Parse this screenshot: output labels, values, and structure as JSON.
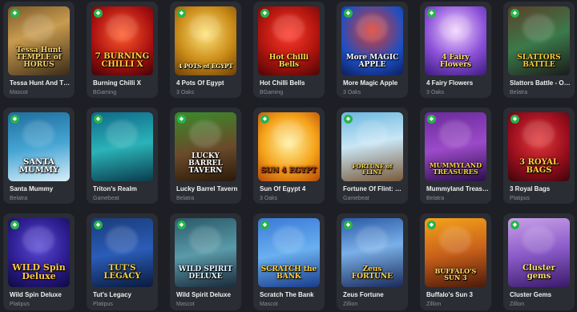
{
  "badge_icon": "diamond-icon",
  "colors": {
    "page_bg": "#1d1f24",
    "card_bg": "#2a2d33",
    "badge": "#27b44b"
  },
  "games": [
    {
      "title": "Tessa Hunt And The...",
      "provider": "Mascot",
      "logo": "Tessa Hunt TEMPLE of HORUS",
      "bg": "linear-gradient(160deg,#7a5a2a,#c89b4e 40%,#3a2a18)",
      "logo_color": "#f5d36b"
    },
    {
      "title": "Burning Chilli X",
      "provider": "BGaming",
      "logo": "7 BURNING CHILLI X",
      "bg": "radial-gradient(circle at 50% 40%,#ff5a2a,#a80f10 60%,#3b0508)",
      "logo_color": "#ffd23a"
    },
    {
      "title": "4 Pots Of Egypt",
      "provider": "3 Oaks",
      "logo": "4 POTS of EGYPT",
      "bg": "radial-gradient(circle at 50% 40%,#ffe37a,#c98a17 55%,#6b3e08)",
      "logo_color": "#fff3b0"
    },
    {
      "title": "Hot Chilli Bells",
      "provider": "BGaming",
      "logo": "Hot Chilli Bells",
      "bg": "radial-gradient(circle at 50% 40%,#ff3a2a,#b1150e 55%,#4a0506)",
      "logo_color": "#ffe14a"
    },
    {
      "title": "More Magic Apple",
      "provider": "3 Oaks",
      "logo": "More MAGIC APPLE",
      "bg": "radial-gradient(circle at 50% 35%,#e23a2a,#1d4fc4 60%,#0b1e5c)",
      "logo_color": "#ffffff"
    },
    {
      "title": "4 Fairy Flowers",
      "provider": "3 Oaks",
      "logo": "4 Fairy Flowers",
      "bg": "radial-gradient(circle at 50% 35%,#f5d6ff,#8a4fd8 55%,#3b1a7a)",
      "logo_color": "#ffe16b"
    },
    {
      "title": "Slattors Battle - Orc...",
      "provider": "Belatra",
      "logo": "SLATTORS BATTLE",
      "bg": "linear-gradient(160deg,#5b3f2a,#3b7a4a 50%,#1a1a1a)",
      "logo_color": "#ffc93a"
    },
    {
      "title": "Santa Mummy",
      "provider": "Belatra",
      "logo": "SANTA MUMMY",
      "bg": "linear-gradient(170deg,#1d6e9c,#46a5d4 50%,#d9eef8)",
      "logo_color": "#ffffff"
    },
    {
      "title": "Triton's Realm",
      "provider": "Gamebeat",
      "logo": "",
      "bg": "linear-gradient(170deg,#0e6a8a,#2bb3b8 50%,#0a3c4d)",
      "logo_color": "#ffffff"
    },
    {
      "title": "Lucky Barrel Tavern",
      "provider": "Belatra",
      "logo": "LUCKY BARREL TAVERN",
      "bg": "linear-gradient(170deg,#3a8a2a,#6a4a2a 55%,#2a1a0a)",
      "logo_color": "#ffffff"
    },
    {
      "title": "Sun Of Egypt 4",
      "provider": "3 Oaks",
      "logo": "SUN 4 EGYPT",
      "bg": "radial-gradient(circle at 50% 45%,#fff2a6,#f5a31a 55%,#b5450a)",
      "logo_color": "#b32a0a"
    },
    {
      "title": "Fortune Of Flint: Ba...",
      "provider": "Gamebeat",
      "logo": "FORTUNE of FLINT",
      "bg": "linear-gradient(170deg,#6ab7e0,#c9e6f5 45%,#7a5a3a)",
      "logo_color": "#ffd23a"
    },
    {
      "title": "Mummyland Treasu...",
      "provider": "Belatra",
      "logo": "MUMMYLAND TREASURES",
      "bg": "linear-gradient(170deg,#6a2a9c,#9c4ac8 50%,#2a0f4a)",
      "logo_color": "#ffd23a"
    },
    {
      "title": "3 Royal Bags",
      "provider": "Platipus",
      "logo": "3 ROYAL BAGS",
      "bg": "radial-gradient(circle at 50% 40%,#e23a3a,#9c0e1e 55%,#3b050a)",
      "logo_color": "#ffd23a"
    },
    {
      "title": "Wild Spin Deluxe",
      "provider": "Platipus",
      "logo": "WILD Spin Deluxe",
      "bg": "radial-gradient(circle at 50% 40%,#5a4ad8,#2a1a8a 60%,#0e0a3c)",
      "logo_color": "#ffc93a"
    },
    {
      "title": "Tut's Legacy",
      "provider": "Platipus",
      "logo": "TUT'S LEGACY",
      "bg": "linear-gradient(170deg,#1a3c7a,#2a5cb8 50%,#0a1a3c)",
      "logo_color": "#ffd23a"
    },
    {
      "title": "Wild Spirit Deluxe",
      "provider": "Mascot",
      "logo": "WILD SPIRIT DELUXE",
      "bg": "linear-gradient(170deg,#2a5a6a,#5a9aa8 50%,#1a2a3a)",
      "logo_color": "#e8f4ff"
    },
    {
      "title": "Scratch The Bank",
      "provider": "Mascot",
      "logo": "SCRATCH the BANK",
      "bg": "linear-gradient(170deg,#3a7ad8,#6ab0f0 50%,#1a3c8a)",
      "logo_color": "#ffd23a"
    },
    {
      "title": "Zeus Fortune",
      "provider": "Zillion",
      "logo": "Zeus FORTUNE",
      "bg": "linear-gradient(170deg,#2a5aa8,#7ab0e8 45%,#1a2a5a)",
      "logo_color": "#ffd23a"
    },
    {
      "title": "Buffalo's Sun 3",
      "provider": "Zillion",
      "logo": "BUFFALO'S SUN 3",
      "bg": "linear-gradient(170deg,#f5a31a,#c8601a 50%,#4a1a0a)",
      "logo_color": "#ffe16b"
    },
    {
      "title": "Cluster Gems",
      "provider": "Zillion",
      "logo": "Cluster gems",
      "bg": "linear-gradient(170deg,#c8a0e8,#8a5ac8 50%,#3a1a6a)",
      "logo_color": "#ffe16b"
    }
  ]
}
